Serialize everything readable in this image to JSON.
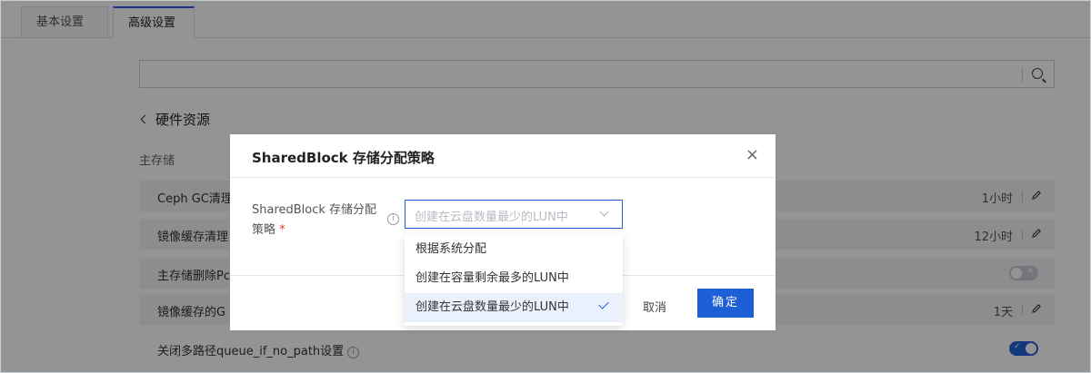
{
  "tabs": [
    {
      "label": "基本设置"
    },
    {
      "label": "高级设置"
    }
  ],
  "search": {
    "placeholder": ""
  },
  "back": {
    "label": "硬件资源"
  },
  "section": {
    "title": "主存储"
  },
  "rows": [
    {
      "label": "Ceph GC清理",
      "value": "1小时",
      "control": "edit"
    },
    {
      "label": "镜像缓存清理",
      "value": "12小时",
      "control": "edit"
    },
    {
      "label": "主存储删除Pc",
      "value": "",
      "control": "toggle-off"
    },
    {
      "label": "镜像缓存的G",
      "value": "1天",
      "control": "edit"
    },
    {
      "label": "关闭多路径queue_if_no_path设置",
      "value": "",
      "control": "toggle-on"
    }
  ],
  "modal": {
    "title": "SharedBlock 存储分配策略",
    "close": "×",
    "field_label": "SharedBlock 存储分配策略",
    "required_mark": "*",
    "selected_value": "创建在云盘数量最少的LUN中",
    "cancel_label": "取消",
    "ok_label": "确定"
  },
  "dropdown": {
    "options": [
      {
        "label": "根据系统分配",
        "selected": false
      },
      {
        "label": "创建在容量剩余最多的LUN中",
        "selected": false
      },
      {
        "label": "创建在云盘数量最少的LUN中",
        "selected": true
      }
    ]
  },
  "colors": {
    "accent": "#1f5fd6",
    "overlay": "rgba(0,0,0,0.42)"
  }
}
